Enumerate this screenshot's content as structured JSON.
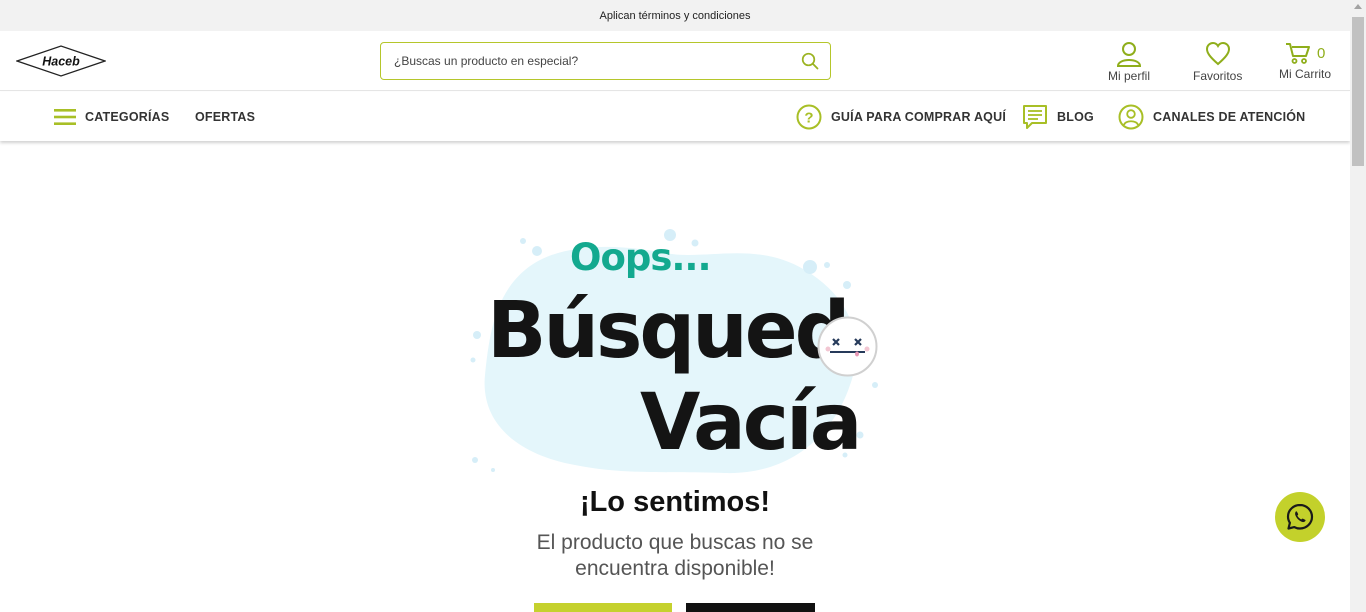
{
  "topbar": {
    "text": "Aplican términos y condiciones"
  },
  "header": {
    "logo_text": "Haceb",
    "search_placeholder": "¿Buscas un producto en especial?",
    "profile_label": "Mi perfil",
    "favorites_label": "Favoritos",
    "cart_label": "Mi Carrito",
    "cart_count": "0"
  },
  "nav": {
    "categories": "CATEGORÍAS",
    "offers": "OFERTAS",
    "guide": "GUÍA PARA COMPRAR AQUÍ",
    "blog": "BLOG",
    "channels": "CANALES DE ATENCIÓN"
  },
  "hero": {
    "oops": "Oops...",
    "title_line1": "Búsqued",
    "title_line2": "Vacía",
    "sorry": "¡Lo sentimos!",
    "description": "El producto que buscas no se encuentra disponible!"
  },
  "colors": {
    "accent": "#c3d12b",
    "teal": "#13a98f",
    "blob": "#e4f6fb"
  },
  "icons": [
    "search-icon",
    "user-icon",
    "heart-icon",
    "cart-icon",
    "menu-icon",
    "question-icon",
    "blog-icon",
    "support-user-icon",
    "whatsapp-icon",
    "sad-face-icon"
  ]
}
